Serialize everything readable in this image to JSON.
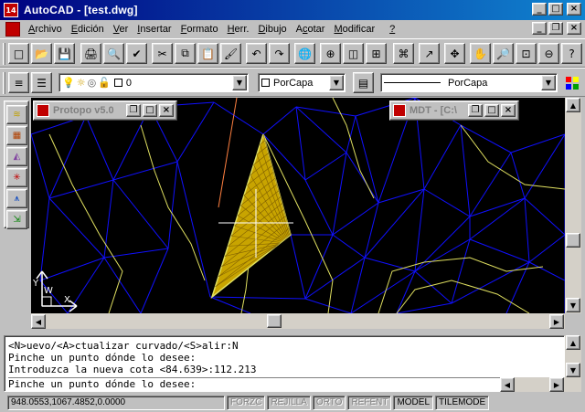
{
  "window": {
    "app_icon_text": "14",
    "title": "AutoCAD - [test.dwg]",
    "controls": {
      "minimize": "_",
      "maximize": "□",
      "close": "×"
    }
  },
  "menubar": {
    "items": [
      {
        "label": "Archivo",
        "key": "A"
      },
      {
        "label": "Edición",
        "key": "E"
      },
      {
        "label": "Ver",
        "key": "V"
      },
      {
        "label": "Insertar",
        "key": "I"
      },
      {
        "label": "Formato",
        "key": "F"
      },
      {
        "label": "Herr.",
        "key": "H"
      },
      {
        "label": "Dibujo",
        "key": "D"
      },
      {
        "label": "Acotar",
        "key": "c"
      },
      {
        "label": "Modificar",
        "key": "M"
      },
      {
        "label": "?",
        "key": "?"
      }
    ],
    "doc_controls": {
      "minimize": "_",
      "restore": "❐",
      "close": "×"
    }
  },
  "toolbar_standard": {
    "icons": [
      "new-icon",
      "open-icon",
      "save-icon",
      "print-icon",
      "print-preview-icon",
      "spell-check-icon",
      "cut-icon",
      "copy-icon",
      "paste-icon",
      "match-properties-icon",
      "undo-icon",
      "redo-icon",
      "hyperlink-icon",
      "tracking-icon",
      "snap-icon",
      "point-filter-icon",
      "draw-order-icon",
      "ucs-icon",
      "aerial-view-icon",
      "pan-icon",
      "zoom-realtime-icon",
      "zoom-window-icon",
      "zoom-previous-icon",
      "help-icon"
    ],
    "glyphs": [
      "□",
      "📂",
      "💾",
      "🖨",
      "🔍",
      "✔",
      "✂",
      "⧉",
      "📋",
      "🖌",
      "↶",
      "↷",
      "🌐",
      "⊕",
      "◫",
      "⊞",
      "⌘",
      "↗",
      "✥",
      "✋",
      "🔎",
      "⊡",
      "⊖",
      "?"
    ]
  },
  "toolbar_layers": {
    "layer_manager_icon": "layers-icon",
    "layer_prev_icon": "layer-previous-icon",
    "layer_value": "0",
    "color_value": "PorCapa",
    "linetype_value": "PorCapa",
    "lineweight_icon": "lineweight-icon",
    "palette_icon": "color-palette-icon",
    "colors": {
      "bulb": "#ffff00",
      "sun": "#ffcc00"
    }
  },
  "palette": {
    "tools": [
      "contour-icon",
      "grid-icon",
      "triangulate-icon",
      "mesh-icon",
      "profile-icon",
      "export-icon"
    ]
  },
  "drawing": {
    "background": "#000000",
    "colors": {
      "triangle_lines": "#1010ff",
      "contours": "#e0e060",
      "fill": "#c8a400",
      "accent": "#ff8040",
      "cursor": "#ffffff"
    },
    "child_windows": [
      {
        "title": "Protopo v5.0"
      },
      {
        "title": "MDT - [C:\\"
      }
    ],
    "ucs": {
      "x_label": "X",
      "y_label": "Y",
      "w_label": "W"
    }
  },
  "command": {
    "lines": [
      "<N>uevo/<A>ctualizar curvado/<S>alir:N",
      "Pinche un punto dónde lo desee:",
      "Introduzca la nueva cota <84.639>:112.213",
      "Pinche un punto dónde lo desee:"
    ]
  },
  "statusbar": {
    "coords": "948.0553,1067.4852,0.0000",
    "toggles": [
      {
        "label": "FORZC",
        "on": false
      },
      {
        "label": "REJILLA",
        "on": false
      },
      {
        "label": "ORTO",
        "on": false
      },
      {
        "label": "REFENT",
        "on": false
      },
      {
        "label": "MODEL",
        "on": true
      },
      {
        "label": "TILEMODE",
        "on": true
      }
    ]
  }
}
